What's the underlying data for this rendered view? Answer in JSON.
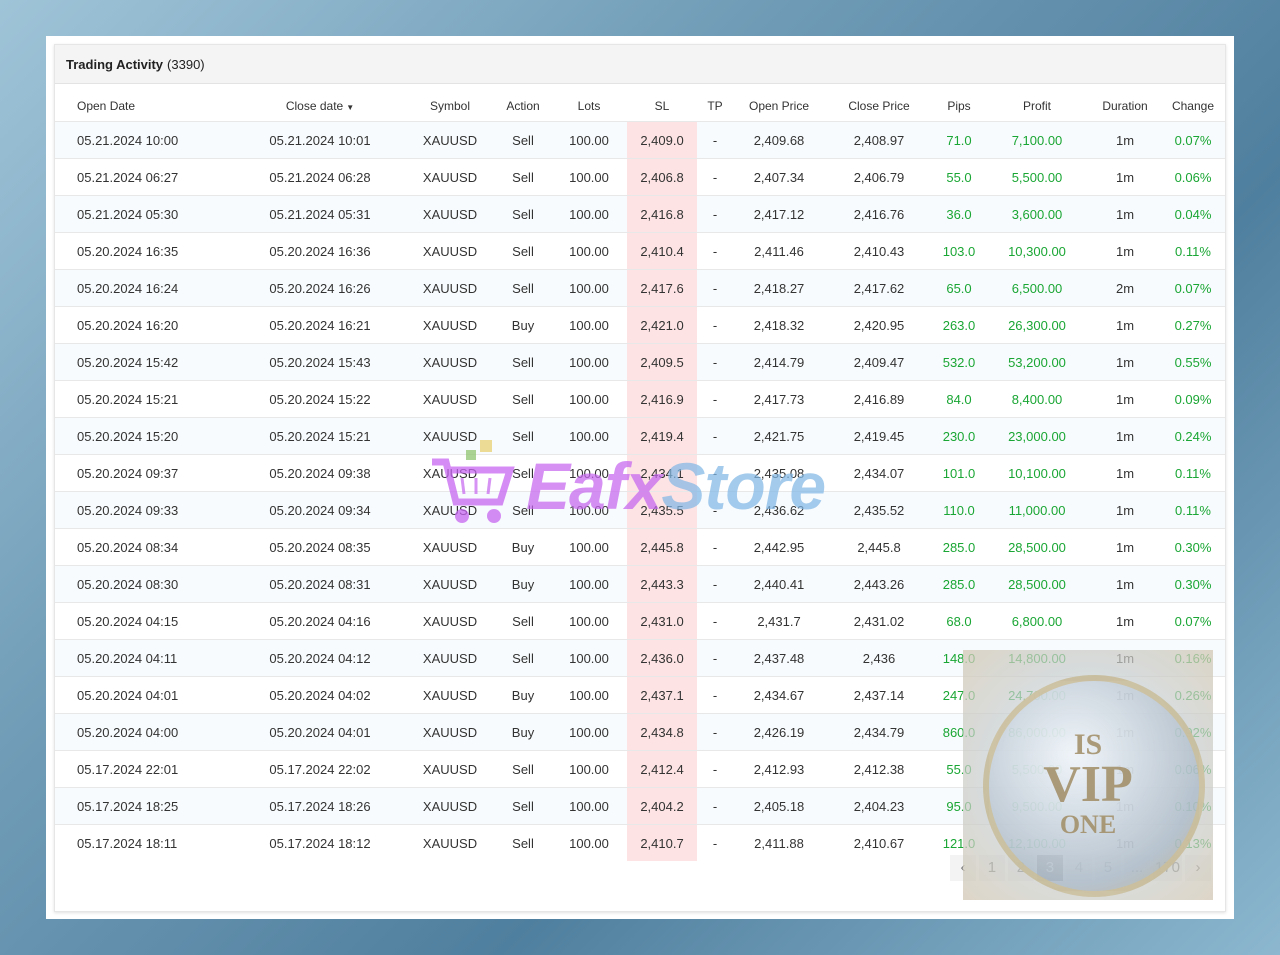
{
  "title": "Trading Activity",
  "count": "(3390)",
  "columns": [
    "Open Date",
    "Close date",
    "Symbol",
    "Action",
    "Lots",
    "SL",
    "TP",
    "Open Price",
    "Close Price",
    "Pips",
    "Profit",
    "Duration",
    "Change"
  ],
  "sort_icon": "caret-down-icon",
  "rows": [
    [
      "05.21.2024 10:00",
      "05.21.2024 10:01",
      "XAUUSD",
      "Sell",
      "100.00",
      "2,409.0",
      "-",
      "2,409.68",
      "2,408.97",
      "71.0",
      "7,100.00",
      "1m",
      "0.07%"
    ],
    [
      "05.21.2024 06:27",
      "05.21.2024 06:28",
      "XAUUSD",
      "Sell",
      "100.00",
      "2,406.8",
      "-",
      "2,407.34",
      "2,406.79",
      "55.0",
      "5,500.00",
      "1m",
      "0.06%"
    ],
    [
      "05.21.2024 05:30",
      "05.21.2024 05:31",
      "XAUUSD",
      "Sell",
      "100.00",
      "2,416.8",
      "-",
      "2,417.12",
      "2,416.76",
      "36.0",
      "3,600.00",
      "1m",
      "0.04%"
    ],
    [
      "05.20.2024 16:35",
      "05.20.2024 16:36",
      "XAUUSD",
      "Sell",
      "100.00",
      "2,410.4",
      "-",
      "2,411.46",
      "2,410.43",
      "103.0",
      "10,300.00",
      "1m",
      "0.11%"
    ],
    [
      "05.20.2024 16:24",
      "05.20.2024 16:26",
      "XAUUSD",
      "Sell",
      "100.00",
      "2,417.6",
      "-",
      "2,418.27",
      "2,417.62",
      "65.0",
      "6,500.00",
      "2m",
      "0.07%"
    ],
    [
      "05.20.2024 16:20",
      "05.20.2024 16:21",
      "XAUUSD",
      "Buy",
      "100.00",
      "2,421.0",
      "-",
      "2,418.32",
      "2,420.95",
      "263.0",
      "26,300.00",
      "1m",
      "0.27%"
    ],
    [
      "05.20.2024 15:42",
      "05.20.2024 15:43",
      "XAUUSD",
      "Sell",
      "100.00",
      "2,409.5",
      "-",
      "2,414.79",
      "2,409.47",
      "532.0",
      "53,200.00",
      "1m",
      "0.55%"
    ],
    [
      "05.20.2024 15:21",
      "05.20.2024 15:22",
      "XAUUSD",
      "Sell",
      "100.00",
      "2,416.9",
      "-",
      "2,417.73",
      "2,416.89",
      "84.0",
      "8,400.00",
      "1m",
      "0.09%"
    ],
    [
      "05.20.2024 15:20",
      "05.20.2024 15:21",
      "XAUUSD",
      "Sell",
      "100.00",
      "2,419.4",
      "-",
      "2,421.75",
      "2,419.45",
      "230.0",
      "23,000.00",
      "1m",
      "0.24%"
    ],
    [
      "05.20.2024 09:37",
      "05.20.2024 09:38",
      "XAUUSD",
      "Sell",
      "100.00",
      "2,434.1",
      "-",
      "2,435.08",
      "2,434.07",
      "101.0",
      "10,100.00",
      "1m",
      "0.11%"
    ],
    [
      "05.20.2024 09:33",
      "05.20.2024 09:34",
      "XAUUSD",
      "Sell",
      "100.00",
      "2,435.5",
      "-",
      "2,436.62",
      "2,435.52",
      "110.0",
      "11,000.00",
      "1m",
      "0.11%"
    ],
    [
      "05.20.2024 08:34",
      "05.20.2024 08:35",
      "XAUUSD",
      "Buy",
      "100.00",
      "2,445.8",
      "-",
      "2,442.95",
      "2,445.8",
      "285.0",
      "28,500.00",
      "1m",
      "0.30%"
    ],
    [
      "05.20.2024 08:30",
      "05.20.2024 08:31",
      "XAUUSD",
      "Buy",
      "100.00",
      "2,443.3",
      "-",
      "2,440.41",
      "2,443.26",
      "285.0",
      "28,500.00",
      "1m",
      "0.30%"
    ],
    [
      "05.20.2024 04:15",
      "05.20.2024 04:16",
      "XAUUSD",
      "Sell",
      "100.00",
      "2,431.0",
      "-",
      "2,431.7",
      "2,431.02",
      "68.0",
      "6,800.00",
      "1m",
      "0.07%"
    ],
    [
      "05.20.2024 04:11",
      "05.20.2024 04:12",
      "XAUUSD",
      "Sell",
      "100.00",
      "2,436.0",
      "-",
      "2,437.48",
      "2,436",
      "148.0",
      "14,800.00",
      "1m",
      "0.16%"
    ],
    [
      "05.20.2024 04:01",
      "05.20.2024 04:02",
      "XAUUSD",
      "Buy",
      "100.00",
      "2,437.1",
      "-",
      "2,434.67",
      "2,437.14",
      "247.0",
      "24,700.00",
      "1m",
      "0.26%"
    ],
    [
      "05.20.2024 04:00",
      "05.20.2024 04:01",
      "XAUUSD",
      "Buy",
      "100.00",
      "2,434.8",
      "-",
      "2,426.19",
      "2,434.79",
      "860.0",
      "86,000.00",
      "1m",
      "0.92%"
    ],
    [
      "05.17.2024 22:01",
      "05.17.2024 22:02",
      "XAUUSD",
      "Sell",
      "100.00",
      "2,412.4",
      "-",
      "2,412.93",
      "2,412.38",
      "55.0",
      "5,500.00",
      "1m",
      "0.06%"
    ],
    [
      "05.17.2024 18:25",
      "05.17.2024 18:26",
      "XAUUSD",
      "Sell",
      "100.00",
      "2,404.2",
      "-",
      "2,405.18",
      "2,404.23",
      "95.0",
      "9,500.00",
      "1m",
      "0.10%"
    ],
    [
      "05.17.2024 18:11",
      "05.17.2024 18:12",
      "XAUUSD",
      "Sell",
      "100.00",
      "2,410.7",
      "-",
      "2,411.88",
      "2,410.67",
      "121.0",
      "12,100.00",
      "1m",
      "0.13%"
    ]
  ],
  "pagination": {
    "prev": "‹",
    "pages": [
      "1",
      "2",
      "3",
      "4",
      "5",
      "...",
      "170"
    ],
    "active": "3",
    "next": "›"
  },
  "watermark": {
    "part1": "Eafx",
    "part2": "Store"
  },
  "badge": {
    "line1": "IS",
    "line2": "VIP",
    "line3": "ONE"
  },
  "colors": {
    "positive": "#1aa634",
    "sl_highlight": "#fde3e3"
  }
}
